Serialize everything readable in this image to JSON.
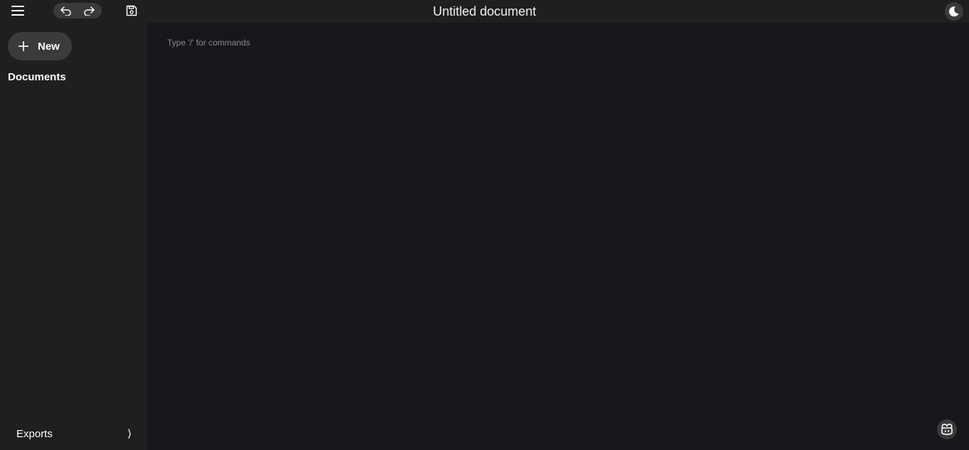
{
  "header": {
    "title": "Untitled document",
    "menu_icon": "hamburger-menu-icon",
    "undo_icon": "undo-icon",
    "redo_icon": "redo-icon",
    "save_icon": "save-icon",
    "theme_icon": "moon-icon"
  },
  "sidebar": {
    "new_label": "New",
    "new_icon": "plus-icon",
    "documents_heading": "Documents",
    "exports_label": "Exports",
    "exports_chevron": "⟩"
  },
  "editor": {
    "placeholder": "Type '/' for commands",
    "assistant_icon": "copilot-icon"
  },
  "colors": {
    "sidebar_bg": "#1f1f1f",
    "editor_bg": "#16171b",
    "pill_bg": "#3a3a3a",
    "text": "#ffffff",
    "placeholder": "#8a8a8a"
  }
}
